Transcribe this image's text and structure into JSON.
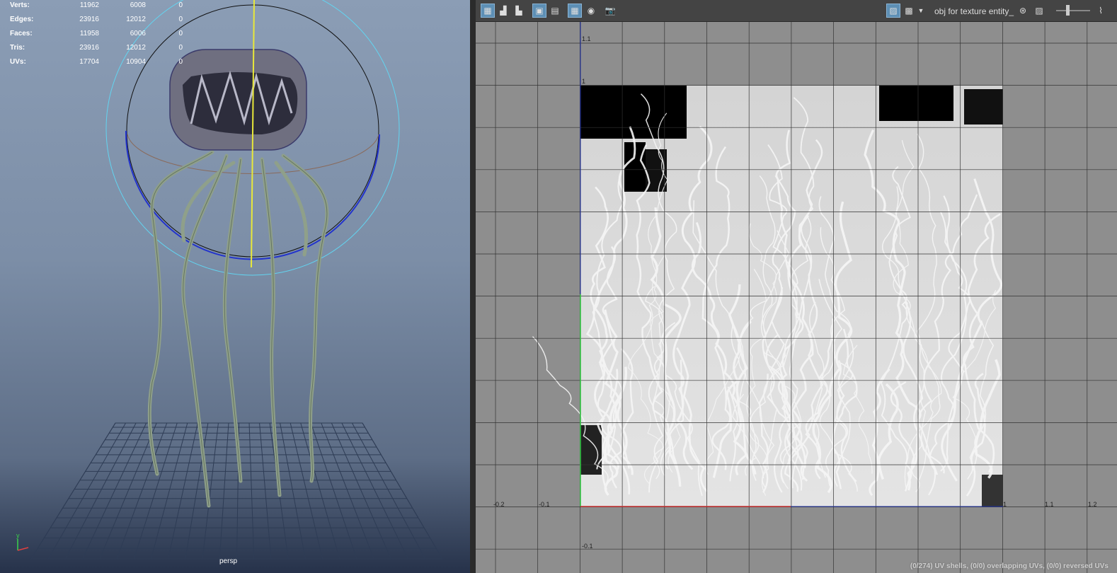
{
  "viewport": {
    "camera": "persp",
    "stats": [
      {
        "label": "Verts:",
        "v1": "11962",
        "v2": "6008",
        "v3": "0"
      },
      {
        "label": "Edges:",
        "v1": "23916",
        "v2": "12012",
        "v3": "0"
      },
      {
        "label": "Faces:",
        "v1": "11958",
        "v2": "6006",
        "v3": "0"
      },
      {
        "label": "Tris:",
        "v1": "23916",
        "v2": "12012",
        "v3": "0"
      },
      {
        "label": "UVs:",
        "v1": "17704",
        "v2": "10904",
        "v3": "0"
      }
    ],
    "axis_label": "y"
  },
  "uv_editor": {
    "toolbar": {
      "texture_name": "obj for texture entity_",
      "icons": [
        "uv-shell-icon",
        "select-mode-icon",
        "select-mode-2-icon",
        "frame-icon",
        "grid-frame-icon",
        "grid-icon",
        "sphere-icon",
        "snapshot-icon",
        "texture-display-icon",
        "checker-icon",
        "dropdown-icon",
        "uv-toggle-icon",
        "image-icon",
        "slider-icon"
      ]
    },
    "ticks": {
      "u": [
        "-0.2",
        "-0.1",
        "1",
        "1.1",
        "1.2"
      ],
      "v": [
        "1.1",
        "1",
        "-0.1"
      ]
    },
    "status": "(0/274) UV shells, (0/0) overlapping UVs, (0/0) reversed UVs",
    "colors": {
      "u_axis": "#c0392b",
      "v_axis": "#2ecc71",
      "selection": "#2233aa"
    }
  }
}
